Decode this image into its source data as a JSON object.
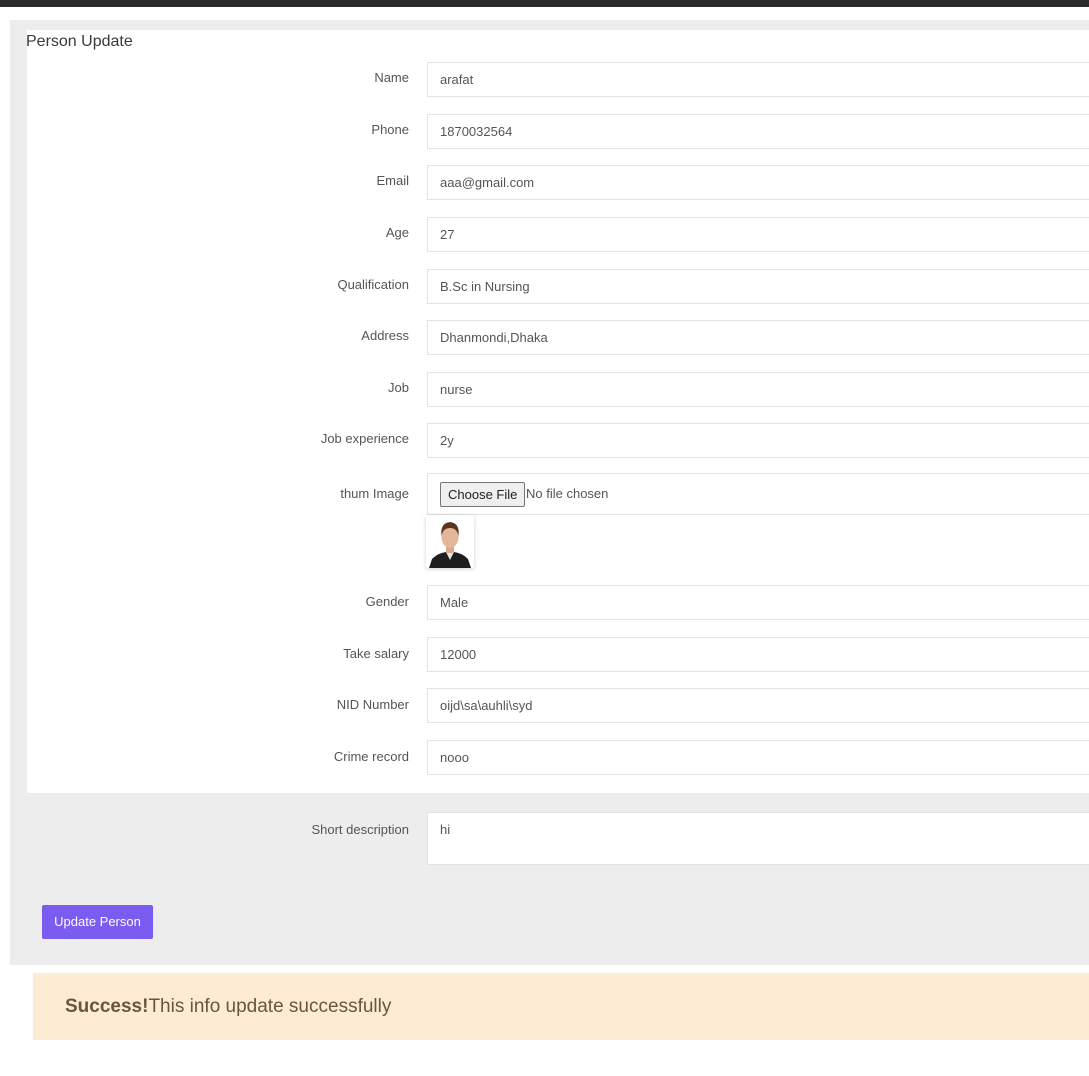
{
  "page": {
    "title": "Person Update"
  },
  "form": {
    "fields": [
      {
        "label": "Name",
        "value": "arafat"
      },
      {
        "label": "Phone",
        "value": "1870032564"
      },
      {
        "label": "Email",
        "value": "aaa@gmail.com"
      },
      {
        "label": "Age",
        "value": "27"
      },
      {
        "label": "Qualification",
        "value": "B.Sc in Nursing"
      },
      {
        "label": "Address",
        "value": "Dhanmondi,Dhaka"
      },
      {
        "label": "Job",
        "value": "nurse"
      },
      {
        "label": "Job experience",
        "value": "2y"
      }
    ],
    "image": {
      "label": "thum Image",
      "button": "Choose File",
      "status": "No file chosen"
    },
    "fields2": [
      {
        "label": "Gender",
        "value": "Male"
      },
      {
        "label": "Take salary",
        "value": "12000"
      },
      {
        "label": "NID Number",
        "value": "oijd\\sa\\auhli\\syd"
      },
      {
        "label": "Crime record",
        "value": "nooo"
      }
    ],
    "description": {
      "label": "Short description",
      "value": "hi"
    },
    "submit_label": "Update Person"
  },
  "alert": {
    "title": "Success!",
    "message": "This info update successfully"
  },
  "colors": {
    "accent": "#7a5cf0",
    "alert_bg": "#fdecd3",
    "outer_bg": "#ededed"
  }
}
